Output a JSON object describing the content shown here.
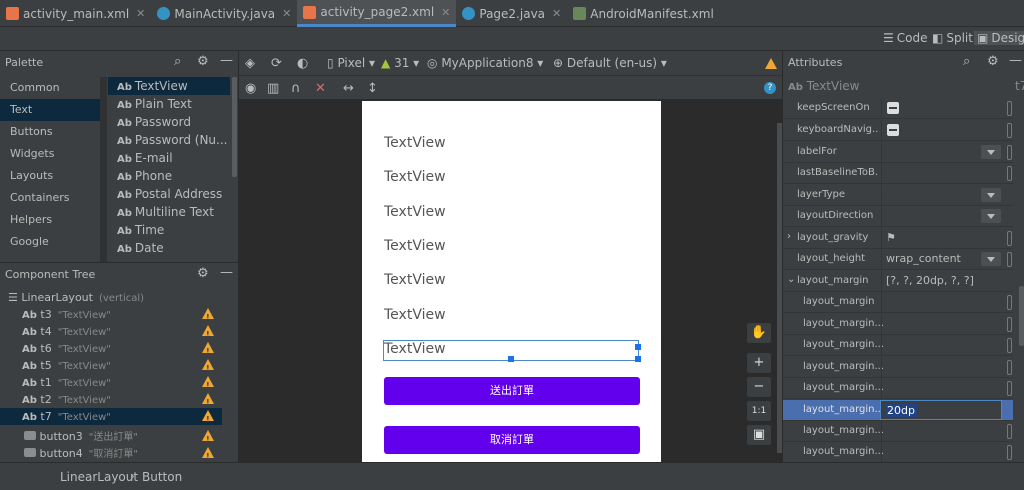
{
  "tabs": [
    {
      "label": "activity_main.xml",
      "icon": "xml-file-icon"
    },
    {
      "label": "MainActivity.java",
      "icon": "java-class-icon"
    },
    {
      "label": "activity_page2.xml",
      "icon": "xml-file-icon"
    },
    {
      "label": "Page2.java",
      "icon": "java-class-icon"
    },
    {
      "label": "AndroidManifest.xml",
      "icon": "manifest-file-icon"
    }
  ],
  "view_modes": {
    "code": "Code",
    "split": "Split",
    "design": "Design"
  },
  "palette": {
    "title": "Palette",
    "categories": [
      "Common",
      "Text",
      "Buttons",
      "Widgets",
      "Layouts",
      "Containers",
      "Helpers",
      "Google"
    ],
    "items": [
      "TextView",
      "Plain Text",
      "Password",
      "Password (Nu...",
      "E-mail",
      "Phone",
      "Postal Address",
      "Multiline Text",
      "Time",
      "Date"
    ],
    "ab": "Ab"
  },
  "tree": {
    "title": "Component Tree",
    "root": "LinearLayout",
    "root_sub": "(vertical)",
    "rows": [
      {
        "id": "t3",
        "sub": "\"TextView\""
      },
      {
        "id": "t4",
        "sub": "\"TextView\""
      },
      {
        "id": "t6",
        "sub": "\"TextView\""
      },
      {
        "id": "t5",
        "sub": "\"TextView\""
      },
      {
        "id": "t1",
        "sub": "\"TextView\""
      },
      {
        "id": "t2",
        "sub": "\"TextView\""
      },
      {
        "id": "t7",
        "sub": "\"TextView\""
      }
    ],
    "buttons": [
      {
        "id": "button3",
        "sub": "\"送出訂單\""
      },
      {
        "id": "button4",
        "sub": "\"取消訂單\""
      }
    ]
  },
  "breadcrumb": [
    "LinearLayout",
    "Button"
  ],
  "design_toolbar": {
    "device": "Pixel",
    "api": "31",
    "app": "MyApplication8",
    "locale": "Default (en-us)"
  },
  "device_screen": {
    "textviews": [
      "TextView",
      "TextView",
      "TextView",
      "TextView",
      "TextView",
      "TextView",
      "TextView"
    ],
    "button_send": "送出訂單",
    "button_cancel": "取消訂單"
  },
  "zoom": {
    "plus": "+",
    "minus": "−",
    "one": "1:1"
  },
  "attributes": {
    "title": "Attributes",
    "selected": "TextView",
    "selected_id": "t7",
    "rows": [
      {
        "name": "keepScreenOn",
        "value": "",
        "type": "check"
      },
      {
        "name": "keyboardNavig...",
        "value": "",
        "type": "check"
      },
      {
        "name": "labelFor",
        "value": "",
        "type": "dd"
      },
      {
        "name": "lastBaselineToB...",
        "value": "",
        "type": "text"
      },
      {
        "name": "layerType",
        "value": "",
        "type": "dd"
      },
      {
        "name": "layoutDirection",
        "value": "",
        "type": "dd"
      },
      {
        "name": "layout_gravity",
        "value": "",
        "type": "flag"
      },
      {
        "name": "layout_height",
        "value": "wrap_content",
        "type": "dd"
      },
      {
        "name": "layout_margin",
        "value": "[?, ?, 20dp, ?, ?]",
        "type": "text"
      },
      {
        "name": "layout_margin",
        "value": "",
        "type": "text"
      },
      {
        "name": "layout_margin...",
        "value": "",
        "type": "text"
      },
      {
        "name": "layout_margin...",
        "value": "",
        "type": "text"
      },
      {
        "name": "layout_margin...",
        "value": "",
        "type": "text"
      },
      {
        "name": "layout_margin...",
        "value": "",
        "type": "text"
      },
      {
        "name": "layout_margin...",
        "value": "20dp",
        "type": "edit"
      },
      {
        "name": "layout_margin...",
        "value": "",
        "type": "text"
      },
      {
        "name": "layout_margin...",
        "value": "",
        "type": "text"
      }
    ]
  }
}
